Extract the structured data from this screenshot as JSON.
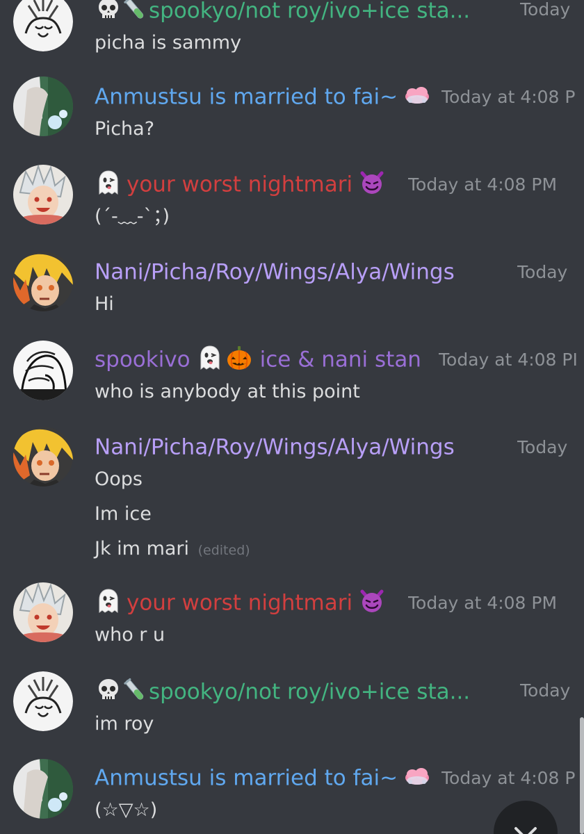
{
  "messages": [
    {
      "username": "spookyo/not roy/ivo+ice sta...",
      "username_color": "#43b581",
      "prefix_emojis": [
        "skull-emoji",
        "test-tube-emoji"
      ],
      "timestamp": "Today",
      "lines": [
        {
          "text": "picha is sammy"
        }
      ]
    },
    {
      "username": "Anmustsu is married to fai~",
      "username_color": "#60a8ef",
      "suffix_emoji": "pink-cloud-emoji",
      "timestamp": "Today at 4:08 P",
      "lines": [
        {
          "text": "Picha?"
        }
      ]
    },
    {
      "username": "your worst nightmari",
      "username_color": "#d23f3f",
      "prefix_emojis": [
        "ghost-emoji"
      ],
      "suffix_emoji": "smiling-imp-emoji",
      "timestamp": "Today at 4:08 PM",
      "lines": [
        {
          "text": "(´-﹏-`；)"
        }
      ]
    },
    {
      "username": "Nani/Picha/Roy/Wings/Alya/Wings",
      "username_color": "#b89ff7",
      "timestamp": "Today",
      "lines": [
        {
          "text": "Hi"
        }
      ]
    },
    {
      "username": "spookivo",
      "username_color": "#9a6fd6",
      "username_suffix": "ice & nani stan",
      "suffix_emojis": [
        "ghost-emoji",
        "jack-o-lantern-emoji"
      ],
      "timestamp": "Today at 4:08 PI",
      "lines": [
        {
          "text": "who is anybody at this point"
        }
      ]
    },
    {
      "username": "Nani/Picha/Roy/Wings/Alya/Wings",
      "username_color": "#b89ff7",
      "timestamp": "Today",
      "lines": [
        {
          "text": "Oops"
        },
        {
          "text": "Im ice"
        },
        {
          "text": "Jk im mari",
          "edited": "(edited)"
        }
      ]
    },
    {
      "username": "your worst nightmari",
      "username_color": "#d23f3f",
      "prefix_emojis": [
        "ghost-emoji"
      ],
      "suffix_emoji": "smiling-imp-emoji",
      "timestamp": "Today at 4:08 PM",
      "lines": [
        {
          "text": "who r  u"
        }
      ]
    },
    {
      "username": "spookyo/not roy/ivo+ice sta...",
      "username_color": "#43b581",
      "prefix_emojis": [
        "skull-emoji",
        "test-tube-emoji"
      ],
      "timestamp": "Today",
      "lines": [
        {
          "text": "im roy"
        }
      ]
    },
    {
      "username": "Anmustsu is married to fai~",
      "username_color": "#60a8ef",
      "suffix_emoji": "pink-cloud-emoji",
      "timestamp": "Today at 4:08 P",
      "lines": [
        {
          "text": "(☆▽☆)"
        }
      ]
    }
  ],
  "jump_button_icon": "chevron-down-icon",
  "colors": {
    "background": "#36393f",
    "timestamp": "#8e9297",
    "message_text": "#dcddde"
  }
}
